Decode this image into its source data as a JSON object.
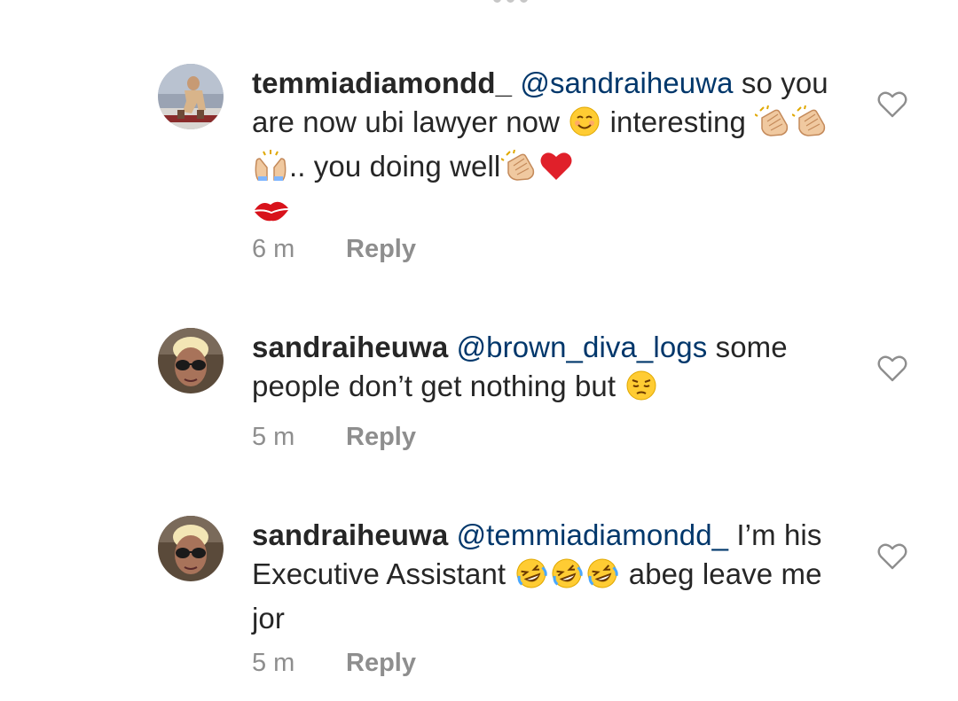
{
  "comments": [
    {
      "username": "temmiadiamondd_",
      "mention": "@sandraiheuwa",
      "segments": [
        {
          "type": "text",
          "value": " so you are now ubi lawyer now "
        },
        {
          "type": "emoji",
          "icon": "smiling-face-emoji"
        },
        {
          "type": "text",
          "value": " interesting "
        },
        {
          "type": "emoji",
          "icon": "clapping-hands-emoji"
        },
        {
          "type": "emoji",
          "icon": "clapping-hands-emoji"
        },
        {
          "type": "emoji",
          "icon": "raising-hands-emoji"
        },
        {
          "type": "text",
          "value": ".. you doing well"
        },
        {
          "type": "emoji",
          "icon": "clapping-hands-emoji"
        },
        {
          "type": "emoji",
          "icon": "red-heart-emoji"
        },
        {
          "type": "emoji",
          "icon": "kiss-mark-emoji"
        }
      ],
      "time": "6 m",
      "reply_label": "Reply",
      "avatar_icon": "user-avatar-temmiadiamondd"
    },
    {
      "username": "sandraiheuwa",
      "mention": "@brown_diva_logs",
      "segments": [
        {
          "type": "text",
          "value": " some people don’t get nothing but "
        },
        {
          "type": "emoji",
          "icon": "pensive-face-emoji"
        }
      ],
      "time": "5 m",
      "reply_label": "Reply",
      "avatar_icon": "user-avatar-sandraiheuwa"
    },
    {
      "username": "sandraiheuwa",
      "mention": "@temmiadiamondd_",
      "segments": [
        {
          "type": "text",
          "value": " I’m his Executive Assistant "
        },
        {
          "type": "emoji",
          "icon": "rolling-laughing-emoji"
        },
        {
          "type": "emoji",
          "icon": "rolling-laughing-emoji"
        },
        {
          "type": "emoji",
          "icon": "rolling-laughing-emoji"
        },
        {
          "type": "text",
          "value": " abeg leave me jor"
        }
      ],
      "time": "5 m",
      "reply_label": "Reply",
      "avatar_icon": "user-avatar-sandraiheuwa"
    }
  ],
  "colors": {
    "text": "#262626",
    "mention": "#00376b",
    "meta": "#8e8e8e",
    "heart_outline": "#8e8e8e"
  }
}
